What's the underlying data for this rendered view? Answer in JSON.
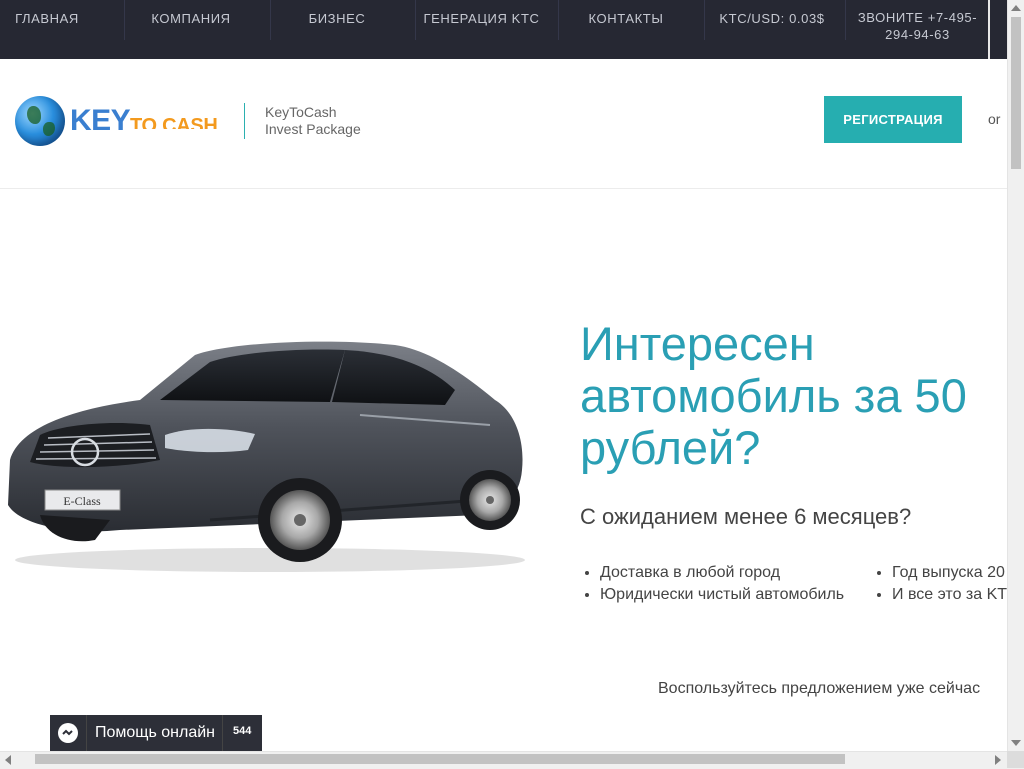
{
  "nav": {
    "items": [
      {
        "label": "ГЛАВНАЯ"
      },
      {
        "label": "КОМПАНИЯ"
      },
      {
        "label": "БИЗНЕС"
      },
      {
        "label": "ГЕНЕРАЦИЯ KTC"
      },
      {
        "label": "КОНТАКТЫ"
      },
      {
        "label": "KTC/USD: 0.03$"
      }
    ],
    "phone": "ЗВОНИТЕ +7-495-294-94-63"
  },
  "header": {
    "logo_key": "KEY",
    "logo_tocash": "TO CASH",
    "tagline_line1": "KeyToCash",
    "tagline_line2": "Invest Package",
    "register_button": "РЕГИСТРАЦИЯ",
    "or_text": "or"
  },
  "hero": {
    "headline": "Интересен автомобиль за 50 рублей?",
    "subheadline": "С ожиданием менее 6 месяцев?",
    "features_left": [
      "Доставка в любой город",
      "Юридически чистый автомобиль"
    ],
    "features_right": [
      "Год выпуска 20",
      "И все это за KT"
    ],
    "cta": "Воспользуйтесь предложением уже сейчас",
    "car_badge": "E-Class"
  },
  "chat_widget": {
    "label": "Помощь онлайн",
    "count": "544"
  },
  "colors": {
    "nav_bg": "#262833",
    "accent": "#26aeb0",
    "headline": "#2a9fb4",
    "logo_blue": "#3a7fd0",
    "logo_orange": "#f39a1e"
  },
  "icons": {
    "logo": "globe-icon",
    "chat": "chat-bubble-icon"
  }
}
